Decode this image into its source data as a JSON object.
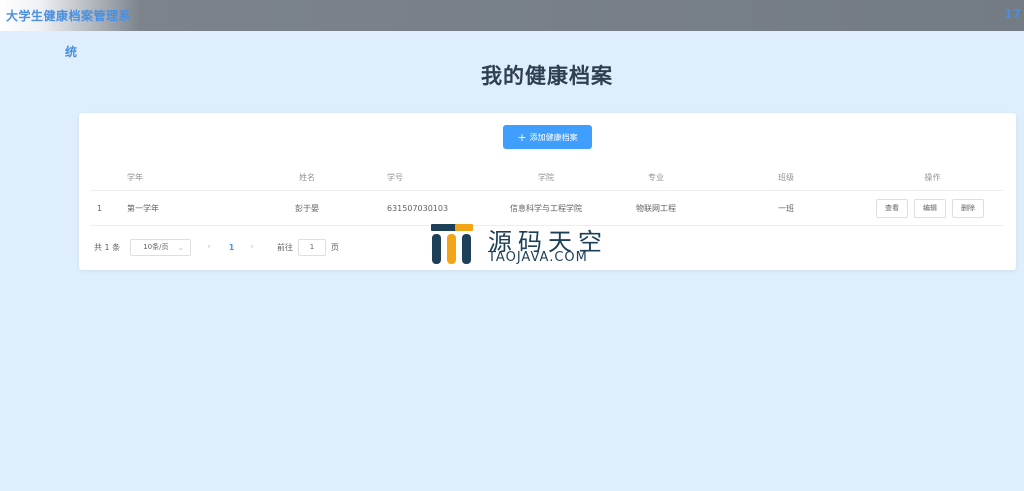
{
  "app": {
    "title": "大学生健康档案管理系",
    "title_overflow": "统",
    "top_right": "17"
  },
  "page": {
    "title": "我的健康档案"
  },
  "toolbar": {
    "add_label": "添加健康档案"
  },
  "table": {
    "headers": [
      "",
      "学年",
      "姓名",
      "学号",
      "学院",
      "专业",
      "班级",
      "操作"
    ],
    "rows": [
      {
        "index": "1",
        "year": "第一学年",
        "name": "彭于晏",
        "student_no": "631507030103",
        "college": "信息科学与工程学院",
        "major": "物联网工程",
        "class": "一班",
        "actions": {
          "view": "查看",
          "edit": "编辑",
          "delete": "删除"
        }
      }
    ]
  },
  "pagination": {
    "total_label": "共 1 条",
    "page_size": "10条/页",
    "current_page": "1",
    "goto_label": "前往",
    "goto_value": "1",
    "page_suffix": "页"
  },
  "watermark": {
    "text": "源码天空",
    "domain": "TAOJAVA.COM"
  },
  "colors": {
    "primary": "#409eff",
    "background": "#dfeefd",
    "title": "#303e52",
    "watermark": "#1d3f58",
    "watermark_accent": "#f2a516"
  }
}
